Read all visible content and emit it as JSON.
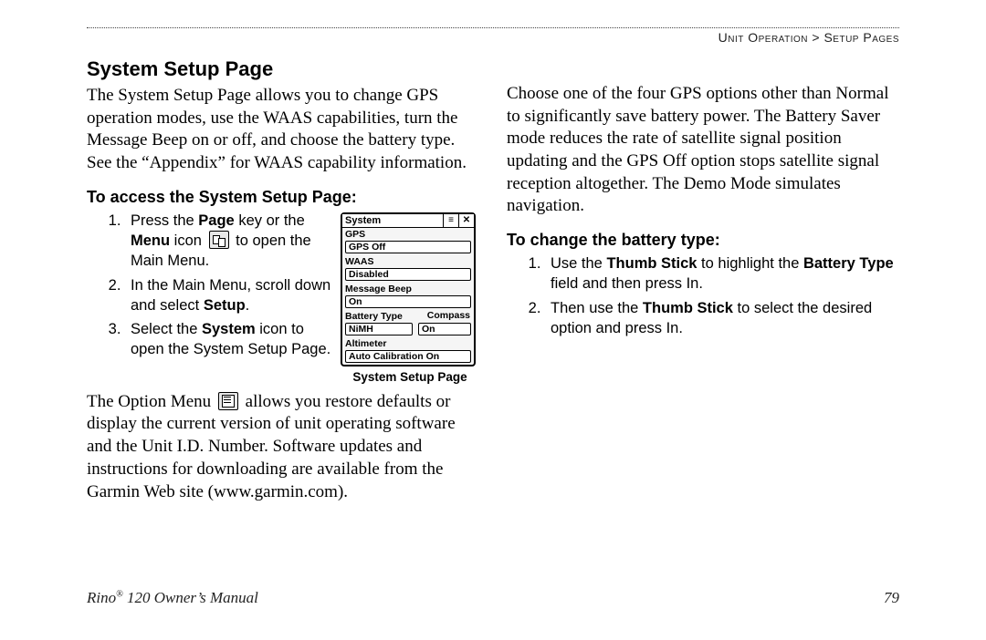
{
  "breadcrumb": {
    "section": "Unit Operation",
    "separator": ">",
    "page": "Setup Pages"
  },
  "left": {
    "heading": "System Setup Page",
    "intro": "The System Setup Page allows you to change GPS operation modes, use the WAAS capabilities, turn the Message Beep on or off, and choose the battery type. See the “Appendix” for WAAS capability information.",
    "sub_heading": "To access the System Setup Page:",
    "steps": {
      "s1a": "Press the ",
      "s1b": "Page",
      "s1c": " key or the ",
      "s1d": "Menu",
      "s1e": " icon ",
      "s1f": " to open the Main Menu.",
      "s2a": "In the Main Menu, scroll down and select ",
      "s2b": "Setup",
      "s2c": ".",
      "s3a": "Select the ",
      "s3b": "System",
      "s3c": " icon to open the System Setup Page."
    },
    "figure": {
      "title": "System",
      "fields": {
        "gps_label": "GPS",
        "gps_value": "GPS Off",
        "waas_label": "WAAS",
        "waas_value": "Disabled",
        "beep_label": "Message Beep",
        "beep_value": "On",
        "batt_label": "Battery Type",
        "batt_side": "Compass",
        "batt_value": "NiMH",
        "batt_side_value": "On",
        "alt_label": "Altimeter",
        "alt_value": "Auto Calibration On"
      },
      "caption": "System Setup Page"
    },
    "option_a": "The Option Menu ",
    "option_b": " allows you restore defaults or display the current version of unit operating software and the Unit I.D. Number. Software updates and instructions for downloading are available from the Garmin Web site (www.garmin.com)."
  },
  "right": {
    "intro": "Choose one of the four GPS options other than Normal to significantly save battery power. The Battery Saver mode reduces the rate of satellite signal position updating and the GPS Off option stops satellite signal reception altogether. The Demo Mode simulates navigation.",
    "sub_heading": "To change the battery type:",
    "steps": {
      "s1a": "Use the ",
      "s1b": "Thumb Stick",
      "s1c": " to highlight the ",
      "s1d": "Battery Type",
      "s1e": " field and then press In.",
      "s2a": "Then use the ",
      "s2b": "Thumb Stick",
      "s2c": " to select the desired option and press In."
    }
  },
  "footer": {
    "product_a": "Rino",
    "product_b": " 120 Owner’s Manual",
    "page_number": "79"
  }
}
